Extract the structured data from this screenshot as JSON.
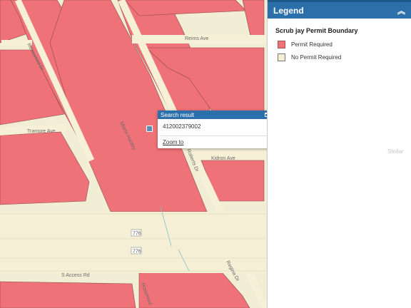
{
  "colors": {
    "permit_required": "#ee7277",
    "no_permit_required": "#f3eed4",
    "road": "#f6f0d6",
    "header": "#2b6fab"
  },
  "map": {
    "roads": [
      "Reims Ave",
      "Rosewood Dr",
      "Tramore Ave",
      "Miami Hardey",
      "Kidron Ave",
      "Roberts Dr",
      "Regina Dr",
      "S Access Rd",
      "Rosemont"
    ],
    "shields": [
      "776",
      "776"
    ]
  },
  "popup": {
    "title": "Search result",
    "value": "412002379002",
    "zoom_label": "Zoom to",
    "more_label": "•••"
  },
  "legend": {
    "title": "Legend",
    "layer_name": "Scrub jay Permit Boundary",
    "items": [
      {
        "label": "Permit Required",
        "color": "#ee7277"
      },
      {
        "label": "No Permit Required",
        "color": "#f3eed4"
      }
    ]
  },
  "watermark": "Stellar"
}
